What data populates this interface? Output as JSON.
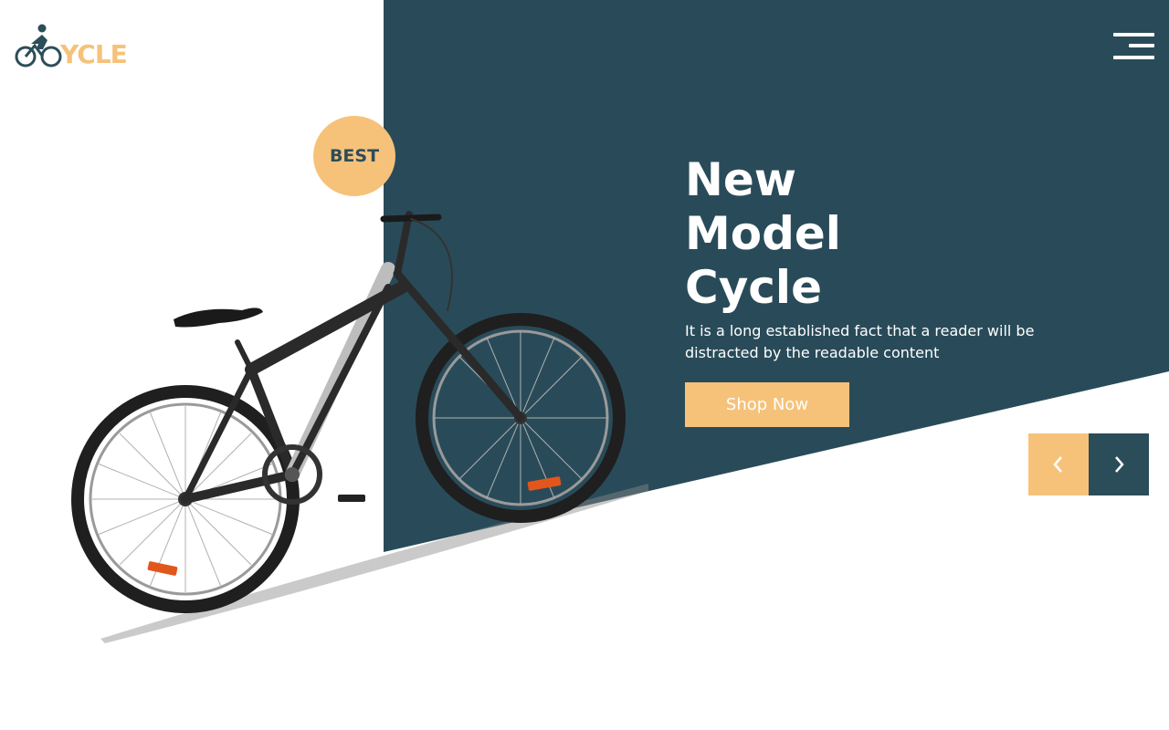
{
  "brand": {
    "logo_text": "YCLE",
    "colors": {
      "dark_teal": "#294b59",
      "accent": "#f6c27a",
      "white": "#ffffff"
    }
  },
  "header": {
    "menu_icon": "hamburger-menu-icon"
  },
  "hero": {
    "badge": "BEST",
    "title_lines": [
      "New",
      "Model",
      "Cycle"
    ],
    "description": "It is a long established fact that a reader will be distracted by the readable content",
    "cta_label": "Shop Now",
    "image": "mountain-bike-image"
  },
  "slider": {
    "prev_icon": "chevron-left-icon",
    "next_icon": "chevron-right-icon"
  }
}
